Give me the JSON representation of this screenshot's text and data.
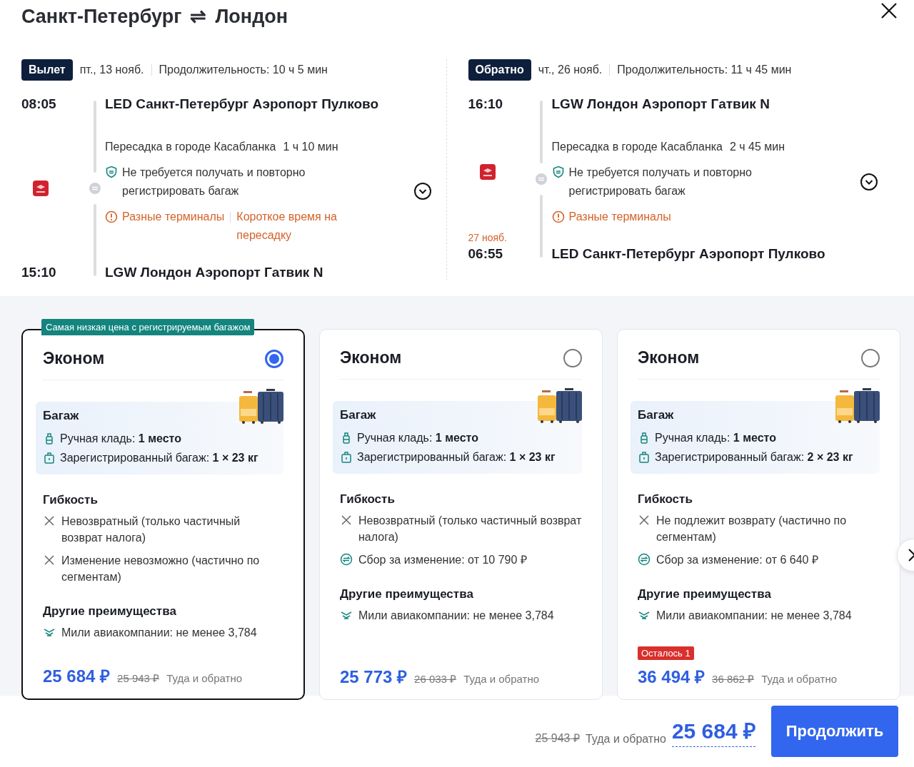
{
  "title": {
    "from": "Санкт-Петербург",
    "arrow": "⇌",
    "to": "Лондон"
  },
  "segments": [
    {
      "badge": "Вылет",
      "date": "пт., 13 нояб.",
      "duration": "Продолжительность: 10 ч 5 мин",
      "depart_time": "08:05",
      "depart_airport": "LED Санкт-Петербург Аэропорт Пулково",
      "transfer_city": "Пересадка в городе Касабланка",
      "transfer_duration": "1 ч 10 мин",
      "baggage_note": "Не требуется получать и повторно регистрировать багаж",
      "warnings": [
        "Разные терминалы",
        "Короткое время на пересадку"
      ],
      "arrive_time": "15:10",
      "arrive_airport": "LGW Лондон Аэропорт Гатвик N"
    },
    {
      "badge": "Обратно",
      "date": "чт., 26 нояб.",
      "duration": "Продолжительность: 11 ч 45 мин",
      "depart_time": "16:10",
      "depart_airport": "LGW Лондон Аэропорт Гатвик N",
      "transfer_city": "Пересадка в городе Касабланка",
      "transfer_duration": "2 ч 45 мин",
      "baggage_note": "Не требуется получать и повторно регистрировать багаж",
      "warnings": [
        "Разные терминалы"
      ],
      "arrive_date": "27 нояб.",
      "arrive_time": "06:55",
      "arrive_airport": "LED Санкт-Петербург Аэропорт Пулково"
    }
  ],
  "fares": [
    {
      "badge": "Самая низкая цена с регистрируемым багажом",
      "name": "Эконом",
      "selected": true,
      "baggage_title": "Багаж",
      "baggage": [
        {
          "kind": "hand",
          "text": "Ручная кладь: **1 место**"
        },
        {
          "kind": "checked",
          "text": "Зарегистрированный багаж: **1 × 23 кг**"
        }
      ],
      "flex_title": "Гибкость",
      "flex": [
        {
          "kind": "no",
          "text": "Невозвратный (только частичный возврат налога)"
        },
        {
          "kind": "no",
          "text": "Изменение невозможно (частично по сегментам)"
        }
      ],
      "other_title": "Другие преимущества",
      "other": [
        "Мили авиакомпании: не менее 3,784"
      ],
      "price": "25 684 ₽",
      "old_price": "25 943 ₽",
      "price_note": "Туда и обратно"
    },
    {
      "name": "Эконом",
      "selected": false,
      "baggage_title": "Багаж",
      "baggage": [
        {
          "kind": "hand",
          "text": "Ручная кладь: **1 место**"
        },
        {
          "kind": "checked",
          "text": "Зарегистрированный багаж: **1 × 23 кг**"
        }
      ],
      "flex_title": "Гибкость",
      "flex": [
        {
          "kind": "no",
          "text": "Невозвратный (только частичный возврат налога)"
        },
        {
          "kind": "fee",
          "text": "Сбор за изменение: от 10 790 ₽"
        }
      ],
      "other_title": "Другие преимущества",
      "other": [
        "Мили авиакомпании: не менее 3,784"
      ],
      "price": "25 773 ₽",
      "old_price": "26 033 ₽",
      "price_note": "Туда и обратно"
    },
    {
      "name": "Эконом",
      "selected": false,
      "baggage_title": "Багаж",
      "baggage": [
        {
          "kind": "hand",
          "text": "Ручная кладь: **1 место**"
        },
        {
          "kind": "checked",
          "text": "Зарегистрированный багаж: **2 × 23 кг**"
        }
      ],
      "flex_title": "Гибкость",
      "flex": [
        {
          "kind": "no",
          "text": "Не подлежит возврату (частично по сегментам)"
        },
        {
          "kind": "fee",
          "text": "Сбор за изменение: от 6 640 ₽"
        }
      ],
      "other_title": "Другие преимущества",
      "other": [
        "Мили авиакомпании: не менее 3,784"
      ],
      "seats_left": "Осталось 1",
      "price": "36 494 ₽",
      "old_price": "36 862 ₽",
      "price_note": "Туда и обратно"
    }
  ],
  "footer": {
    "old_price": "25 943 ₽",
    "note": "Туда и обратно",
    "price": "25 684 ₽",
    "button": "Продолжить"
  }
}
